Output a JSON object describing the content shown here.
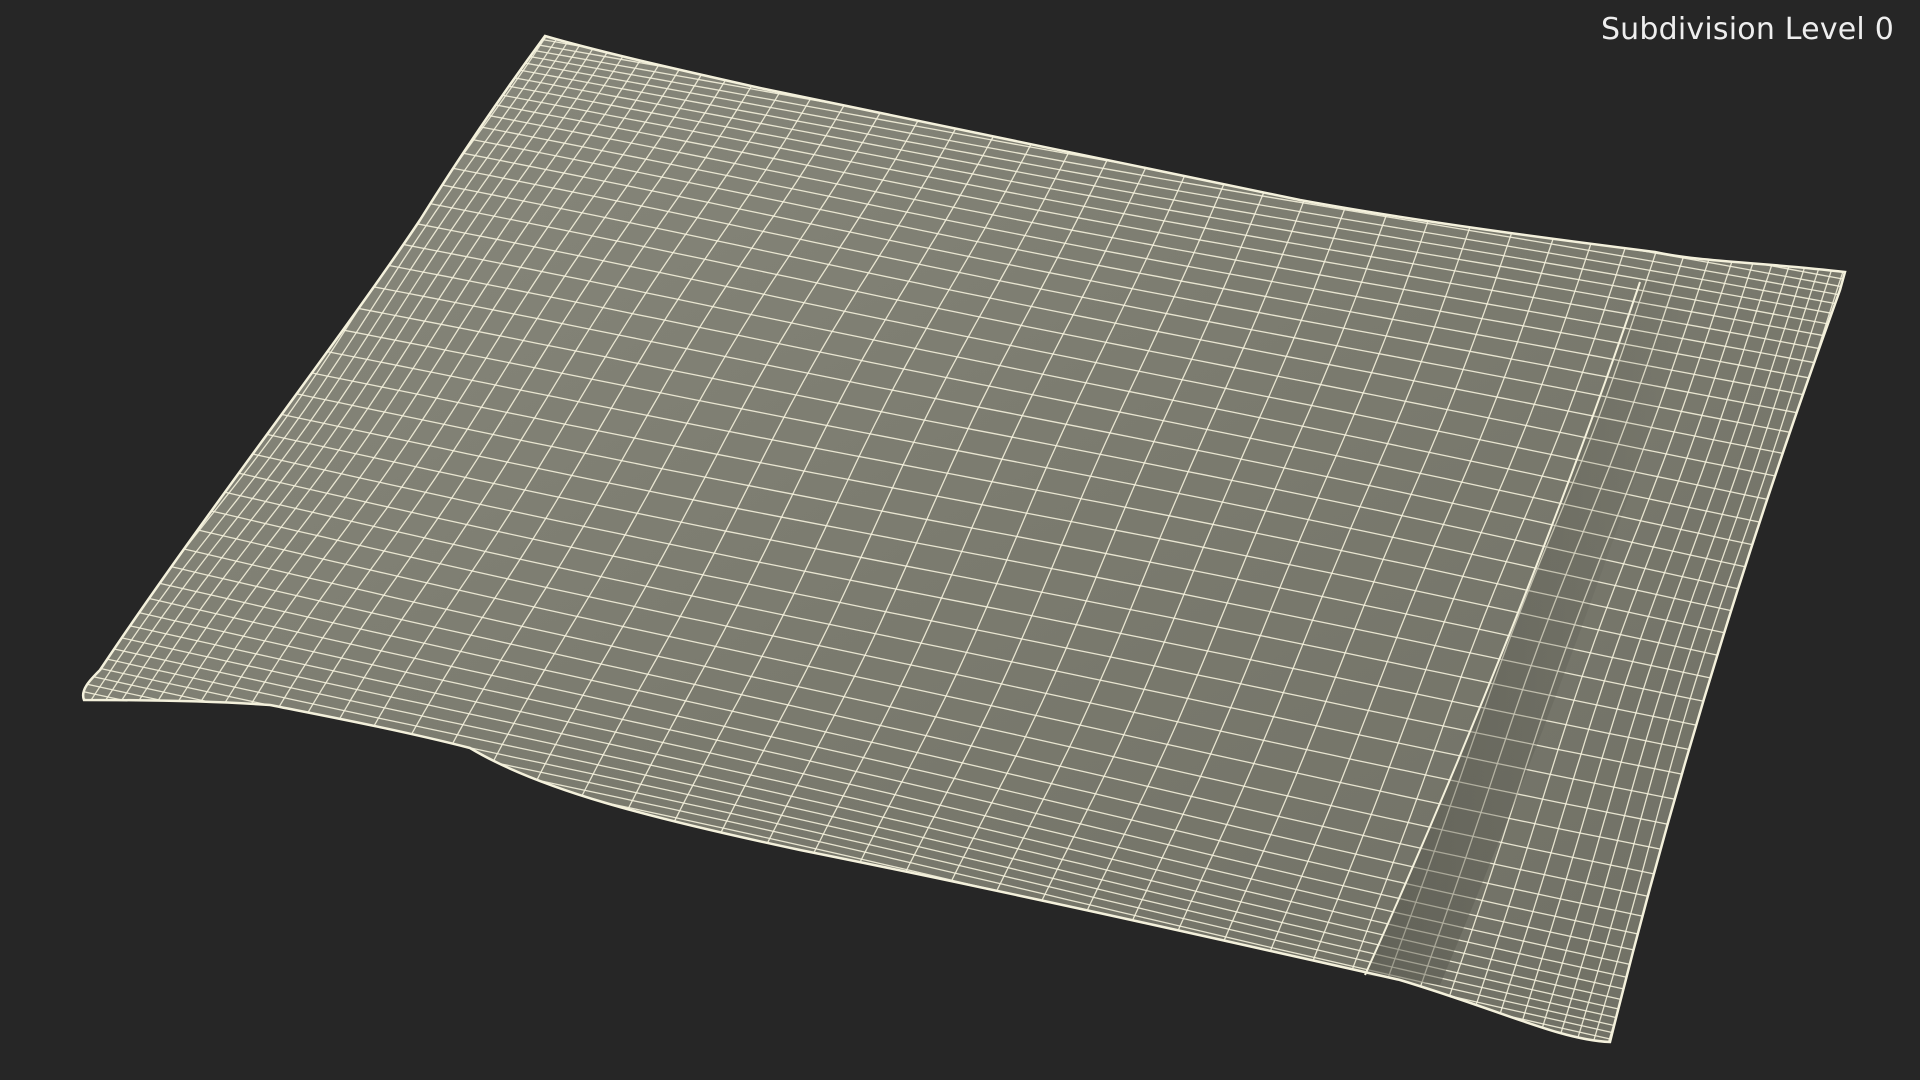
{
  "viewport": {
    "label": "Subdivision Level 0",
    "background_color": "#262626",
    "surface_color": "#7b7b6f",
    "wire_color": "#f4f1dc"
  },
  "model": {
    "subject": "cloth-sheet-wireframe",
    "icon": "wireframe-mesh-icon"
  }
}
